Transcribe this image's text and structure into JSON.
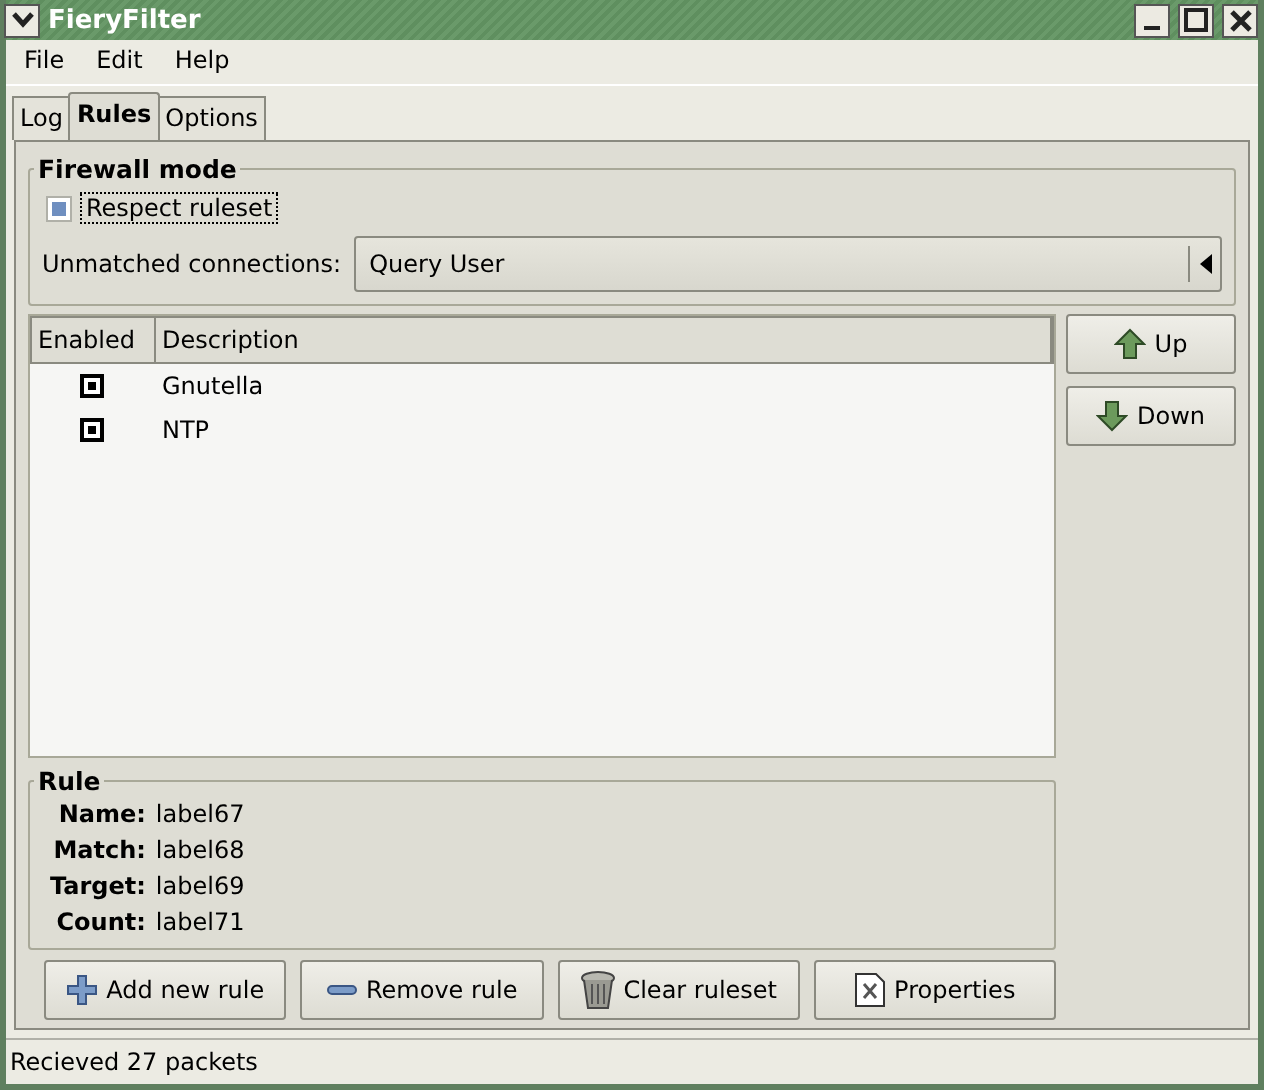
{
  "window": {
    "title": "FieryFilter"
  },
  "menu": [
    "File",
    "Edit",
    "Help"
  ],
  "tabs": [
    {
      "label": "Log",
      "selected": false
    },
    {
      "label": "Rules",
      "selected": true
    },
    {
      "label": "Options",
      "selected": false
    }
  ],
  "firewall_mode": {
    "title": "Firewall mode",
    "respect_ruleset": {
      "label": "Respect ruleset",
      "checked": true
    },
    "unmatched_label": "Unmatched connections:",
    "unmatched_value": "Query User"
  },
  "rules_table": {
    "columns": [
      "Enabled",
      "Description"
    ],
    "rows": [
      {
        "enabled": true,
        "description": "Gnutella"
      },
      {
        "enabled": true,
        "description": "NTP"
      }
    ]
  },
  "side_buttons": [
    {
      "kind": "up",
      "label": "Up"
    },
    {
      "kind": "down",
      "label": "Down"
    }
  ],
  "rule": {
    "title": "Rule",
    "fields": [
      {
        "label": "Name:",
        "value": "label67"
      },
      {
        "label": "Match:",
        "value": "label68"
      },
      {
        "label": "Target:",
        "value": "label69"
      },
      {
        "label": "Count:",
        "value": "label71"
      }
    ]
  },
  "buttons": [
    {
      "kind": "add",
      "label": "Add new rule"
    },
    {
      "kind": "remove",
      "label": "Remove rule"
    },
    {
      "kind": "clear",
      "label": "Clear ruleset"
    },
    {
      "kind": "properties",
      "label": "Properties"
    }
  ],
  "status_bar": "Recieved 27 packets"
}
